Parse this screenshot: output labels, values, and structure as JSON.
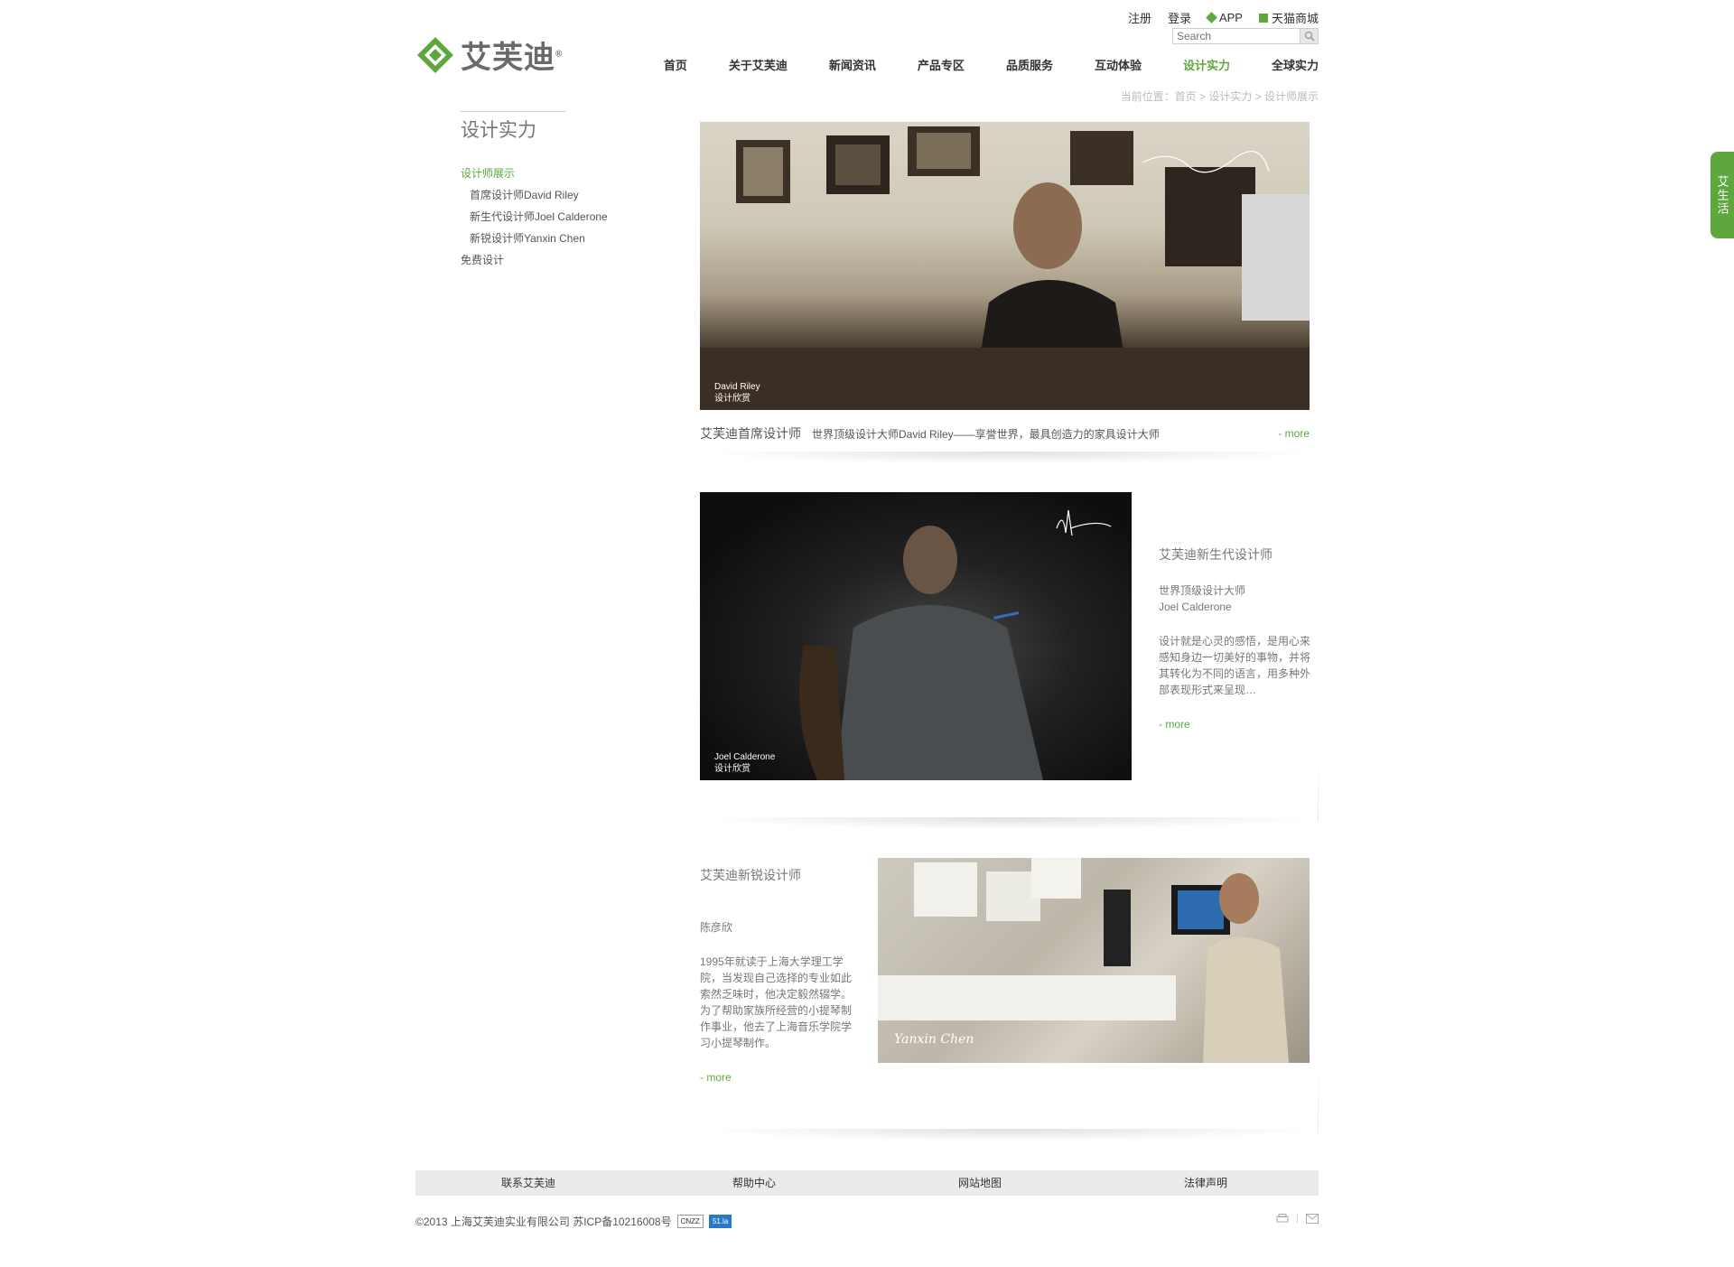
{
  "top_links": {
    "register": "注册",
    "login": "登录",
    "app": "APP",
    "tmall": "天猫商城"
  },
  "search": {
    "placeholder": "Search"
  },
  "logo": {
    "text": "艾芙迪",
    "reg": "®"
  },
  "nav": [
    "首页",
    "关于艾芙迪",
    "新闻资讯",
    "产品专区",
    "品质服务",
    "互动体验",
    "设计实力",
    "全球实力"
  ],
  "breadcrumb": "当前位置：首页 > 设计实力 > 设计师展示",
  "sidebar": {
    "title": "设计实力",
    "items": [
      {
        "label": "设计师展示"
      },
      {
        "label": "首席设计师David Riley"
      },
      {
        "label": "新生代设计师Joel Calderone"
      },
      {
        "label": "新锐设计师Yanxin Chen"
      },
      {
        "label": "免费设计"
      }
    ]
  },
  "designer1": {
    "caption_name": "David Riley",
    "caption_sub": "设计欣赏",
    "title": "艾芙迪首席设计师",
    "text": "世界顶级设计大师David Riley——享誉世界，最具创造力的家具设计大师",
    "more": "- more"
  },
  "designer2": {
    "caption_name": "Joel Calderone",
    "caption_sub": "设计欣赏",
    "title": "艾芙迪新生代设计师",
    "line1": "世界顶级设计大师",
    "line2": "Joel Calderone",
    "text": "设计就是心灵的感悟，是用心来感知身边一切美好的事物，并将其转化为不同的语言，用多种外部表现形式来呈现…",
    "more": "- more"
  },
  "designer3": {
    "signature": "Yanxin Chen",
    "title": "艾芙迪新锐设计师",
    "name": "陈彦欣",
    "text": "1995年就读于上海大学理工学院，当发现自己选择的专业如此索然乏味时，他决定毅然辍学。为了帮助家族所经营的小提琴制作事业，他去了上海音乐学院学习小提琴制作。",
    "more": "- more"
  },
  "footer": {
    "links": [
      "联系艾芙迪",
      "帮助中心",
      "网站地图",
      "法律声明"
    ],
    "copyright": "©2013 上海艾芙迪实业有限公司 苏ICP备10216008号",
    "badges": [
      "CNZZ",
      "51.la"
    ]
  },
  "side_tab": "艾生活",
  "colors": {
    "accent": "#5ea73c",
    "footer_bg": "#ebebeb"
  }
}
